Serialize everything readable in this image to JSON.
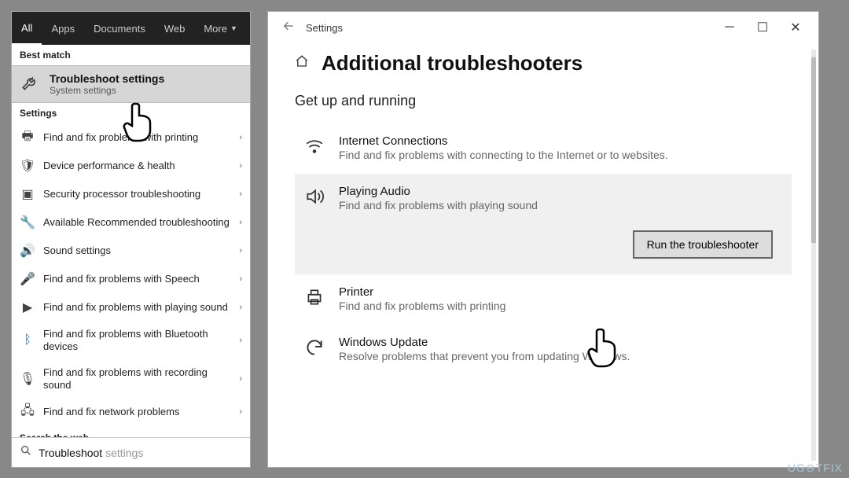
{
  "search": {
    "tabs": [
      "All",
      "Apps",
      "Documents",
      "Web",
      "More"
    ],
    "best_match_label": "Best match",
    "best_title_prefix": "Troubleshoot",
    "best_title_suffix": " settings",
    "best_sub": "System settings",
    "settings_label": "Settings",
    "items": [
      "Find and fix problems with printing",
      "Device performance & health",
      "Security processor troubleshooting",
      "Available Recommended troubleshooting",
      "Sound settings",
      "Find and fix problems with Speech",
      "Find and fix problems with playing sound",
      "Find and fix problems with Bluetooth devices",
      "Find and fix problems with recording sound",
      "Find and fix network problems"
    ],
    "search_web_label": "Search the web",
    "query_typed": "Troubleshoot",
    "query_hint": " settings"
  },
  "settings": {
    "title": "Settings",
    "page_heading": "Additional troubleshooters",
    "section": "Get up and running",
    "troubleshooters": [
      {
        "name": "Internet Connections",
        "desc": "Find and fix problems with connecting to the Internet or to websites."
      },
      {
        "name": "Playing Audio",
        "desc": "Find and fix problems with playing sound"
      },
      {
        "name": "Printer",
        "desc": "Find and fix problems with printing"
      },
      {
        "name": "Windows Update",
        "desc": "Resolve problems that prevent you from updating Windows."
      }
    ],
    "run_button": "Run the troubleshooter"
  },
  "watermark": "UG⊖TFIX"
}
